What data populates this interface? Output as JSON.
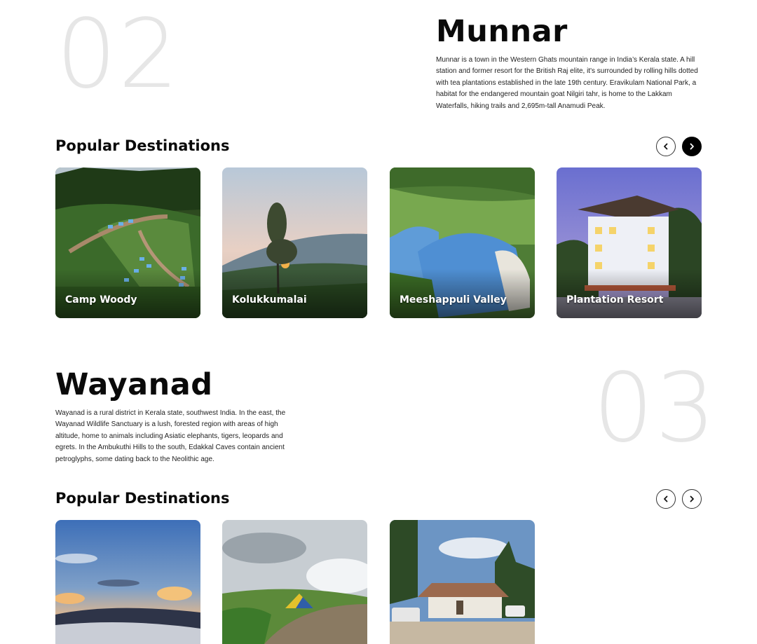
{
  "sections": [
    {
      "number": "02",
      "title": "Munnar",
      "description": "Munnar is a town in the Western Ghats mountain range in India’s Kerala state. A hill station and former resort for the British Raj elite, it's surrounded by rolling hills dotted with tea plantations established in the late 19th century. Eravikulam National Park, a habitat for the endangered mountain goat Nilgiri tahr, is home to the Lakkam Waterfalls, hiking trails and 2,695m-tall Anamudi Peak.",
      "popular_heading": "Popular Destinations",
      "destinations": [
        {
          "name": "Camp Woody"
        },
        {
          "name": "Kolukkumalai"
        },
        {
          "name": "Meeshappuli Valley"
        },
        {
          "name": "Plantation Resort"
        }
      ]
    },
    {
      "number": "03",
      "title": "Wayanad",
      "description": "Wayanad is a rural district in Kerala state, southwest India. In the east, the Wayanad Wildlife Sanctuary is a lush, forested region with areas of high altitude, home to animals including Asiatic elephants, tigers, leopards and egrets. In the Ambukuthi Hills to the south, Edakkal Caves contain ancient petroglyphs, some dating back to the Neolithic age.",
      "popular_heading": "Popular Destinations",
      "destinations": [
        {
          "name": ""
        },
        {
          "name": ""
        },
        {
          "name": ""
        }
      ]
    }
  ],
  "icons": {
    "prev": "chevron-left-icon",
    "next": "chevron-right-icon"
  },
  "colors": {
    "big_number": "#e6e6e6",
    "active_nav": "#000000",
    "text": "#0a0a0a"
  }
}
